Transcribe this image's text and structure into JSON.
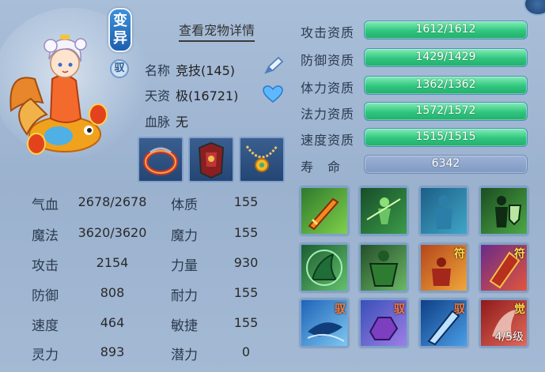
{
  "header": {
    "tag_variant": "变异",
    "tag_yu": "驭",
    "detail_link": "查看宠物详情"
  },
  "info": {
    "name_label": "名称",
    "name_value": "竞技(145)",
    "talent_label": "天资",
    "talent_value": "极(16721)",
    "blood_label": "血脉",
    "blood_value": "无"
  },
  "stats": [
    {
      "label": "气血",
      "value": "2678/2678",
      "label2": "体质",
      "value2": "155"
    },
    {
      "label": "魔法",
      "value": "3620/3620",
      "label2": "魔力",
      "value2": "155"
    },
    {
      "label": "攻击",
      "value": "2154",
      "label2": "力量",
      "value2": "930"
    },
    {
      "label": "防御",
      "value": "808",
      "label2": "耐力",
      "value2": "155"
    },
    {
      "label": "速度",
      "value": "464",
      "label2": "敏捷",
      "value2": "155"
    },
    {
      "label": "灵力",
      "value": "893",
      "label2": "潜力",
      "value2": "0"
    }
  ],
  "aptitudes": [
    {
      "label": "攻击资质",
      "value": "1612/1612",
      "fill": 1.0
    },
    {
      "label": "防御资质",
      "value": "1429/1429",
      "fill": 1.0
    },
    {
      "label": "体力资质",
      "value": "1362/1362",
      "fill": 1.0
    },
    {
      "label": "法力资质",
      "value": "1572/1572",
      "fill": 1.0
    },
    {
      "label": "速度资质",
      "value": "1515/1515",
      "fill": 1.0
    }
  ],
  "lifespan": {
    "label": "寿　命",
    "value": "6342"
  },
  "skills": [
    {
      "icon": "flaming-sword-icon",
      "tag": ""
    },
    {
      "icon": "green-warrior-slash-icon",
      "tag": ""
    },
    {
      "icon": "blue-shadow-figure-icon",
      "tag": ""
    },
    {
      "icon": "green-shield-soldier-icon",
      "tag": ""
    },
    {
      "icon": "green-claw-icon",
      "tag": ""
    },
    {
      "icon": "green-giant-icon",
      "tag": ""
    },
    {
      "icon": "red-fighter-talisman-icon",
      "tag": "符"
    },
    {
      "icon": "fire-scroll-talisman-icon",
      "tag": "符"
    },
    {
      "icon": "blue-horn-icon",
      "tag": "驭"
    },
    {
      "icon": "purple-fist-icon",
      "tag": "驭"
    },
    {
      "icon": "blue-blade-icon",
      "tag": "驭"
    },
    {
      "icon": "red-awaken-icon",
      "tag": "觉",
      "level": "4/5级"
    }
  ],
  "colors": {
    "bar_green": "#2fc67e",
    "bar_life": "#8ea7cd",
    "background": "#a3b9d4",
    "tag_blue": "#2f7fcf"
  }
}
